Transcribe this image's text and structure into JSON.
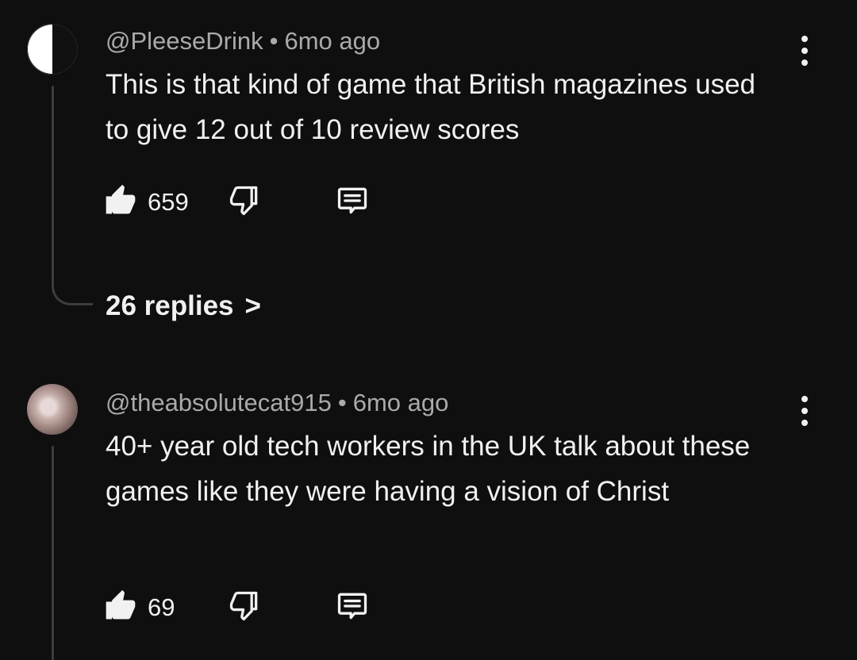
{
  "comments": [
    {
      "author": "@PleeseDrink",
      "time": "6mo ago",
      "text": "This is that kind of game that British magazines used to give 12 out of 10 review scores",
      "likes": "659",
      "replies": "26 replies",
      "avatar_icon": "half-circle-avatar"
    },
    {
      "author": "@theabsolutecat915",
      "time": "6mo ago",
      "text": "40+ year old tech workers in the UK talk about these games like they were having a vision of Christ",
      "likes": "69",
      "avatar_icon": "cat-photo-avatar"
    }
  ],
  "ui": {
    "separator": "•",
    "replies_chevron": ">"
  },
  "colors": {
    "background": "#0f0f0f",
    "primary_text": "#f1f1f1",
    "secondary_text": "#aaaaaa",
    "thread_line": "#3d3d3d"
  }
}
